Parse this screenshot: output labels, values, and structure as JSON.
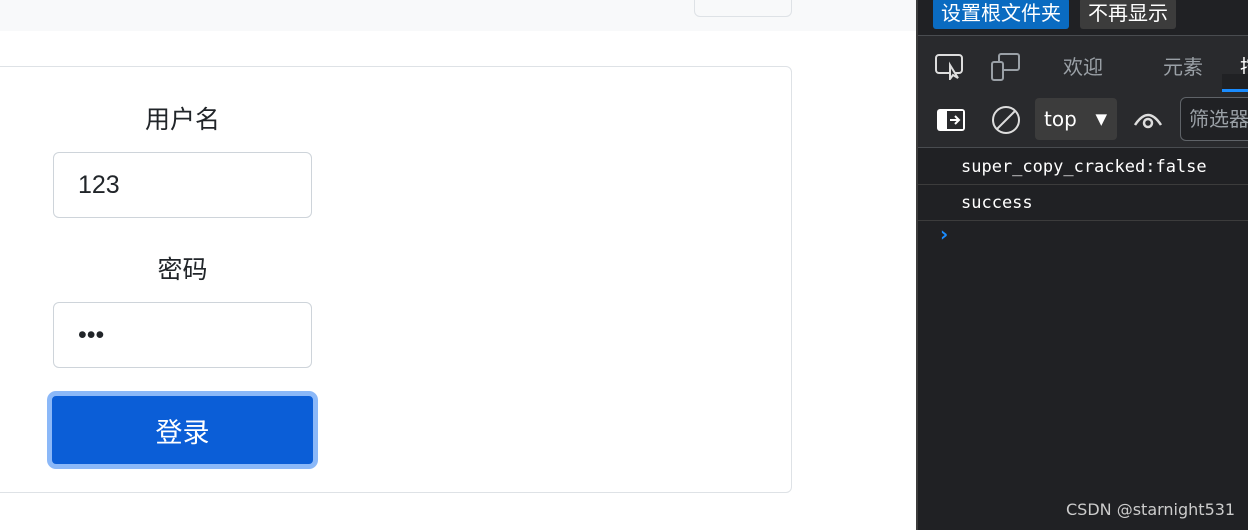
{
  "form": {
    "username_label": "用户名",
    "username_value": "123",
    "password_label": "密码",
    "password_value": "•••",
    "login_button": "登录"
  },
  "devtools": {
    "banner": {
      "set_root": "设置根文件夹",
      "dont_show": "不再显示"
    },
    "tabs": [
      "欢迎",
      "元素",
      "控制台"
    ],
    "context": "top",
    "filter_placeholder": "筛选器",
    "messages": [
      "super_copy_cracked:false",
      "success"
    ]
  },
  "watermark": "CSDN @starnight531",
  "colors": {
    "primary": "#0b5ed7",
    "devtools_bg": "#202124",
    "accent": "#1a8cff"
  }
}
